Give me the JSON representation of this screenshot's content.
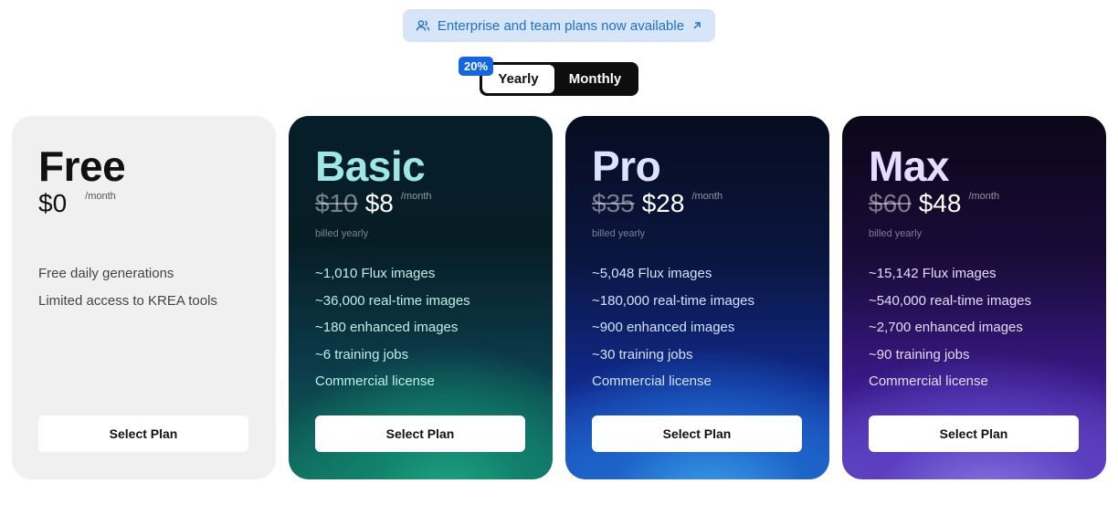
{
  "announcement": {
    "text": "Enterprise and team plans now available",
    "icon": "users-icon",
    "arrow_icon": "arrow-up-right-icon"
  },
  "billing_toggle": {
    "discount_badge": "20%",
    "options": [
      {
        "label": "Yearly",
        "selected": true
      },
      {
        "label": "Monthly",
        "selected": false
      }
    ]
  },
  "plans": [
    {
      "name": "Free",
      "old_price": "",
      "price": "$0",
      "per": "/month",
      "billed": "",
      "features": [
        "Free daily generations",
        "Limited access to KREA tools"
      ],
      "button": "Select Plan"
    },
    {
      "name": "Basic",
      "old_price": "$10",
      "price": "$8",
      "per": "/month",
      "billed": "billed yearly",
      "features": [
        "~1,010 Flux images",
        "~36,000 real-time images",
        "~180 enhanced images",
        "~6 training jobs",
        "Commercial license"
      ],
      "button": "Select Plan"
    },
    {
      "name": "Pro",
      "old_price": "$35",
      "price": "$28",
      "per": "/month",
      "billed": "billed yearly",
      "features": [
        "~5,048 Flux images",
        "~180,000 real-time images",
        "~900 enhanced images",
        "~30 training jobs",
        "Commercial license"
      ],
      "button": "Select Plan"
    },
    {
      "name": "Max",
      "old_price": "$60",
      "price": "$48",
      "per": "/month",
      "billed": "billed yearly",
      "features": [
        "~15,142 Flux images",
        "~540,000 real-time images",
        "~2,700 enhanced images",
        "~90 training jobs",
        "Commercial license"
      ],
      "button": "Select Plan"
    }
  ],
  "colors": {
    "accent_blue": "#1565e0",
    "announce_bg": "#d6e6f8",
    "announce_text": "#1f6fd1"
  }
}
